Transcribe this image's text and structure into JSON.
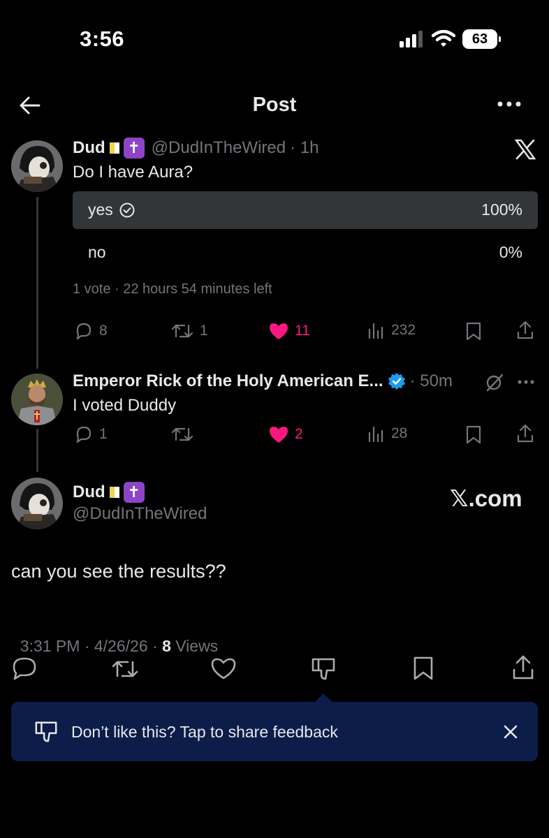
{
  "status_bar": {
    "time": "3:56",
    "battery": "63"
  },
  "header": {
    "title": "Post"
  },
  "poll_tweet": {
    "name": "Dud",
    "handle": "@DudInTheWired",
    "time": "· 1h",
    "text": "Do I have Aura?",
    "options": [
      {
        "label": "yes",
        "percent": "100%",
        "share": 1.0,
        "selected": true
      },
      {
        "label": "no",
        "percent": "0%",
        "share": 0.0,
        "selected": false
      }
    ],
    "meta": "1 vote · 22 hours 54 minutes left",
    "stats": {
      "replies": "8",
      "reposts": "1",
      "likes": "11",
      "views": "232"
    }
  },
  "reply": {
    "name": "Emperor Rick of the Holy American E...",
    "time": "· 50m",
    "text": "I voted Duddy",
    "stats": {
      "replies": "1",
      "reposts": "",
      "likes": "2",
      "views": "28"
    }
  },
  "main_tweet": {
    "name": "Dud",
    "handle": "@DudInTheWired",
    "brand": "𝕏.com",
    "text": "can you see the results??",
    "timestamp": "3:31 PM · 4/26/26 · ",
    "views_count": "8",
    "views_label": " Views"
  },
  "toast": {
    "text": "Don’t like this? Tap to share feedback"
  },
  "colors": {
    "like": "#f91880",
    "verified": "#1d9bf0",
    "toast_bg": "#0c1d4a"
  }
}
